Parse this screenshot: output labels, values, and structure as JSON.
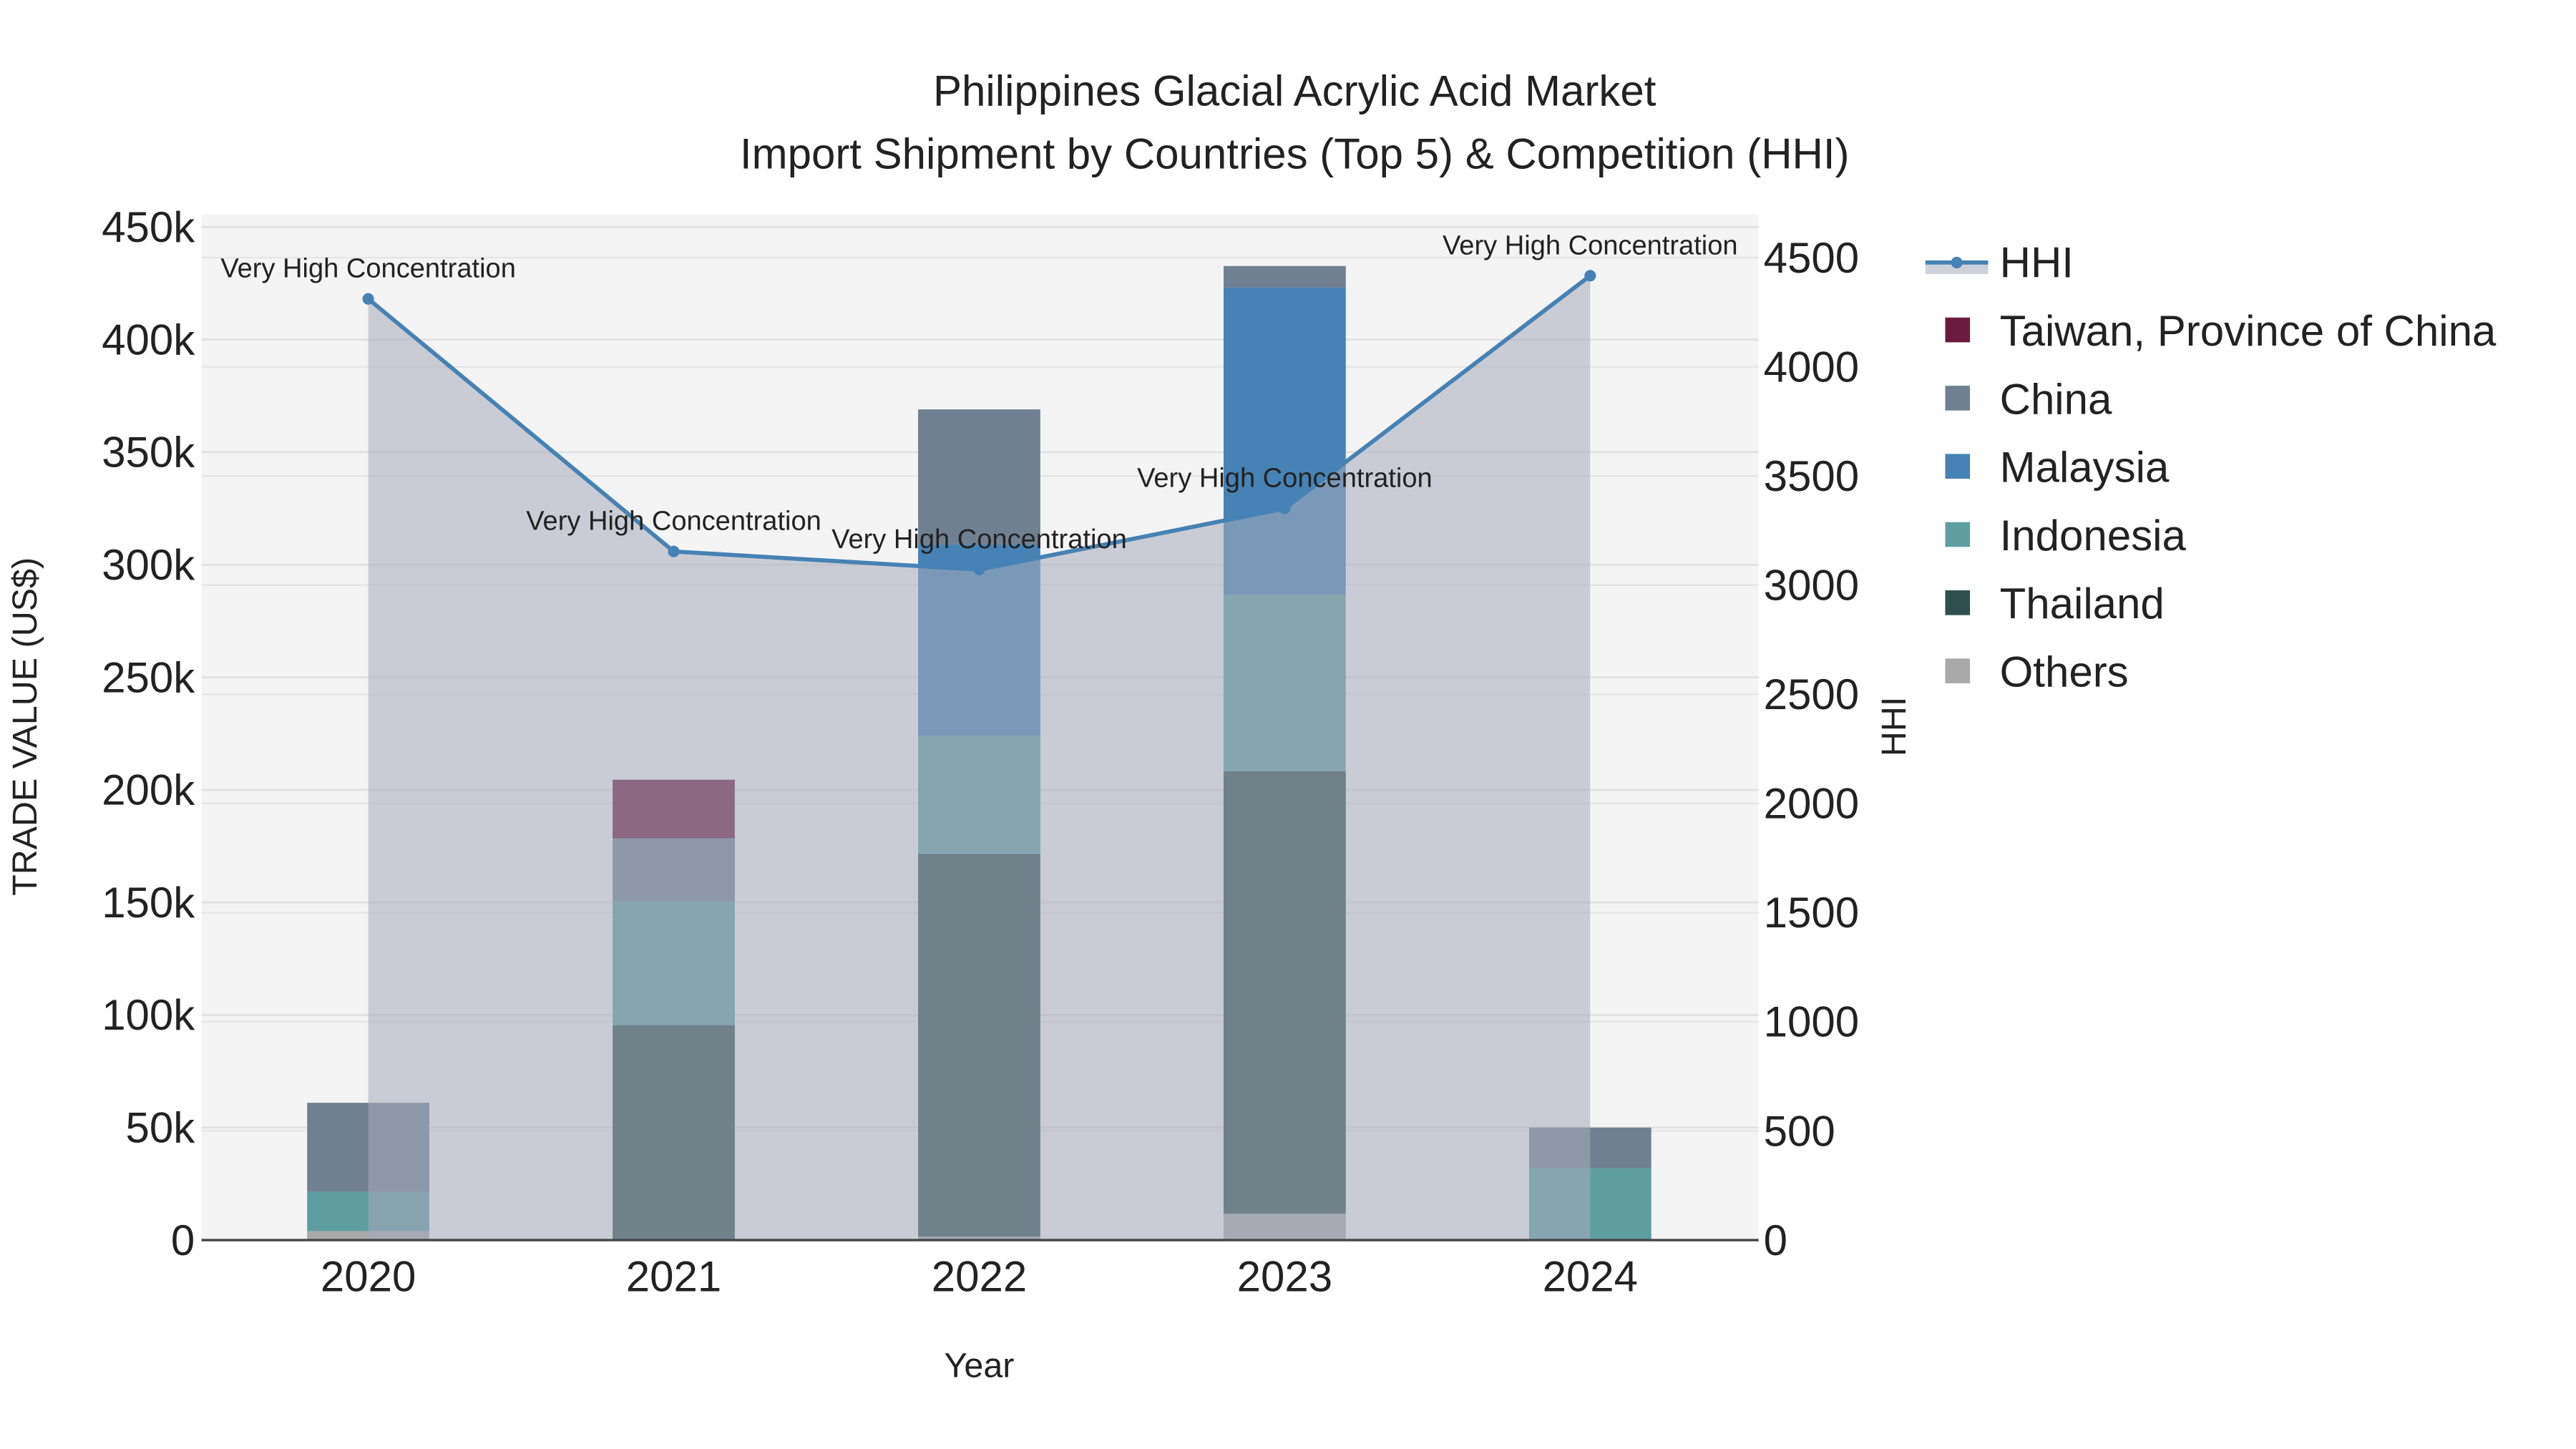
{
  "chart_data": {
    "type": "bar",
    "stacked": true,
    "title": "Philippines Glacial Acrylic Acid Market",
    "subtitle": "Import Shipment by Countries (Top 5) & Competition (HHI)",
    "xlabel": "Year",
    "ylabel": "TRADE VALUE (US$)",
    "y2label": "HHI",
    "categories": [
      "2020",
      "2021",
      "2022",
      "2023",
      "2024"
    ],
    "ylim": [
      0,
      450000
    ],
    "y2lim": [
      0,
      4500
    ],
    "yticks": [
      0,
      50000,
      100000,
      150000,
      200000,
      250000,
      300000,
      350000,
      400000,
      450000
    ],
    "ytick_labels": [
      "0",
      "50k",
      "100k",
      "150k",
      "200k",
      "250k",
      "300k",
      "350k",
      "400k",
      "450k"
    ],
    "y2ticks": [
      0,
      500,
      1000,
      1500,
      2000,
      2500,
      3000,
      3500,
      4000,
      4500
    ],
    "y2tick_labels": [
      "0",
      "500",
      "1000",
      "1500",
      "2000",
      "2500",
      "3000",
      "3500",
      "4000",
      "4500"
    ],
    "grid": true,
    "legend_position": "right",
    "series": [
      {
        "name": "Others",
        "color": "#a9a9a9",
        "values": [
          4000,
          500,
          1500,
          11700,
          0
        ]
      },
      {
        "name": "Thailand",
        "color": "#2f4f4f",
        "values": [
          0,
          95000,
          170000,
          196500,
          0
        ]
      },
      {
        "name": "Indonesia",
        "color": "#5f9ea0",
        "values": [
          17500,
          55000,
          52500,
          78500,
          32000
        ]
      },
      {
        "name": "Malaysia",
        "color": "#4682b4",
        "values": [
          0,
          0,
          85000,
          136500,
          0
        ]
      },
      {
        "name": "China",
        "color": "#708090",
        "values": [
          39500,
          28000,
          60000,
          9500,
          18000
        ]
      },
      {
        "name": "Taiwan, Province of China",
        "color": "#6b1a3f",
        "values": [
          0,
          26000,
          0,
          0,
          0
        ]
      }
    ],
    "hhi": {
      "name": "HHI",
      "color": "#4682b4",
      "values": [
        4311,
        3154,
        3071,
        3351,
        4417
      ],
      "annotations": [
        "Very High Concentration",
        "Very High Concentration",
        "Very High Concentration",
        "Very High Concentration",
        "Very High Concentration"
      ]
    },
    "legend_order": [
      "HHI",
      "Taiwan, Province of China",
      "China",
      "Malaysia",
      "Indonesia",
      "Thailand",
      "Others"
    ]
  }
}
